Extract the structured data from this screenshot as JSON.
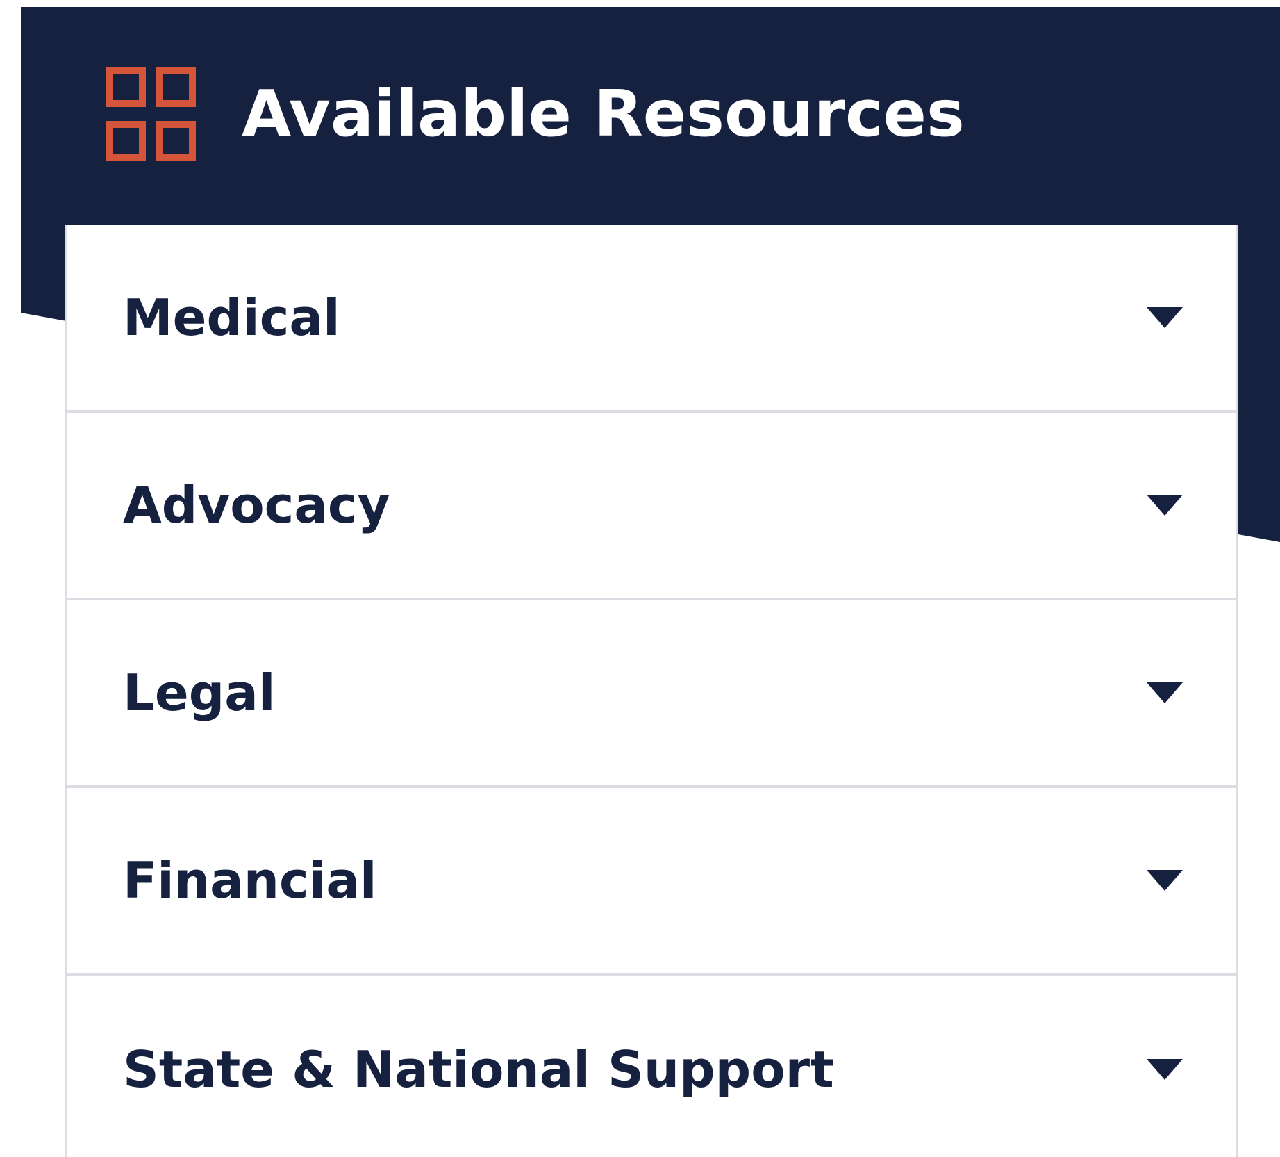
{
  "header": {
    "title": "Available Resources",
    "icon": "grid-icon"
  },
  "colors": {
    "navy": "#16203f",
    "accent": "#d4553a",
    "divider": "#dcdde3"
  },
  "accordion": {
    "items": [
      {
        "label": "Medical",
        "icon": "chevron-down-icon",
        "expanded": false
      },
      {
        "label": "Advocacy",
        "icon": "chevron-down-icon",
        "expanded": false
      },
      {
        "label": "Legal",
        "icon": "chevron-down-icon",
        "expanded": false
      },
      {
        "label": "Financial",
        "icon": "chevron-down-icon",
        "expanded": false
      },
      {
        "label": "State & National Support",
        "icon": "chevron-down-icon",
        "expanded": false
      }
    ]
  }
}
